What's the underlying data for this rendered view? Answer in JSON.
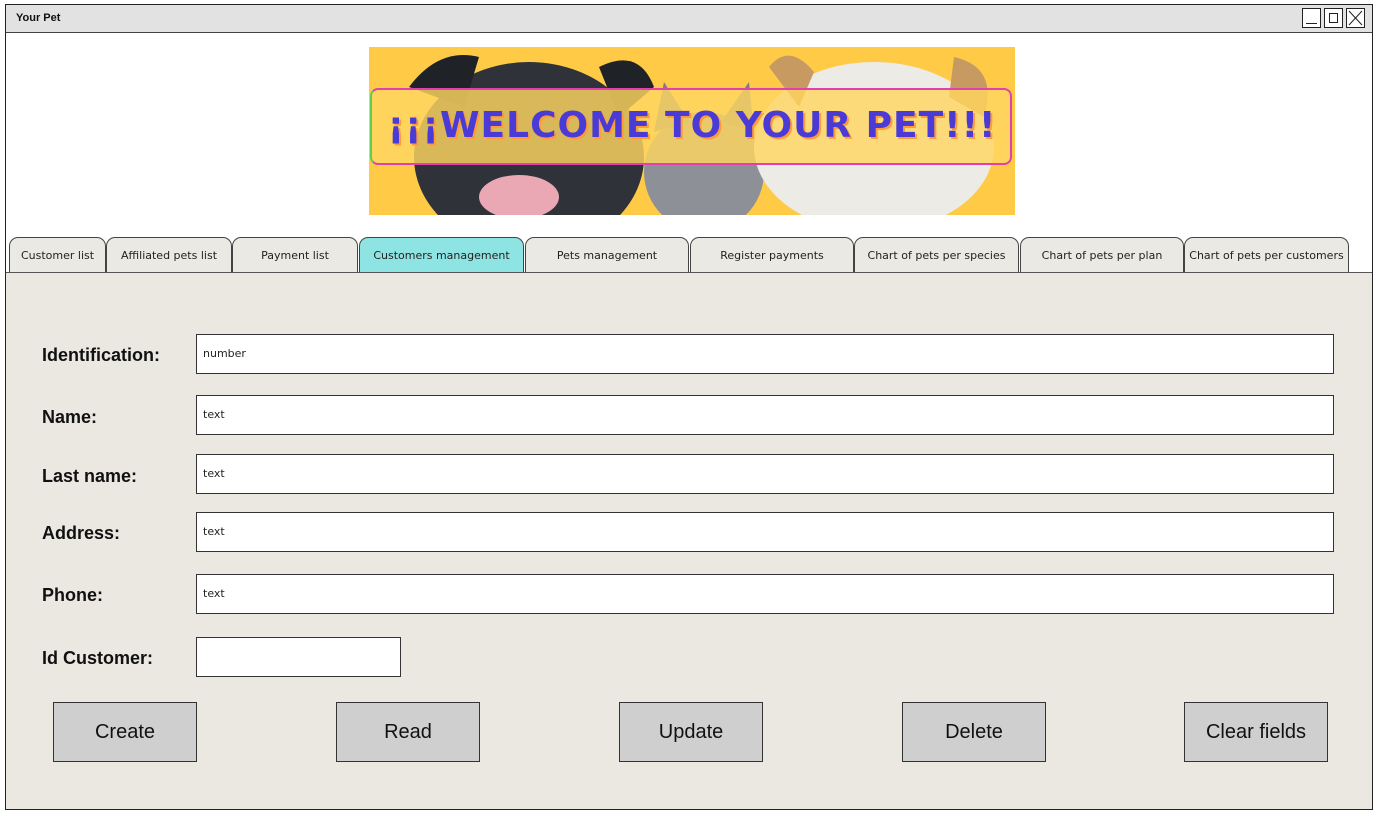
{
  "window": {
    "title": "Your Pet"
  },
  "banner": {
    "text": "¡¡¡WELCOME TO YOUR PET!!!"
  },
  "tabs": [
    {
      "label": "Customer list"
    },
    {
      "label": "Affiliated pets list"
    },
    {
      "label": "Payment list"
    },
    {
      "label": "Customers management",
      "active": true
    },
    {
      "label": "Pets management"
    },
    {
      "label": "Register payments"
    },
    {
      "label": "Chart of pets per species"
    },
    {
      "label": "Chart of pets per plan"
    },
    {
      "label": "Chart of pets per customers"
    }
  ],
  "form": {
    "identification": {
      "label": "Identification:",
      "value": "number"
    },
    "name": {
      "label": "Name:",
      "value": "text"
    },
    "last_name": {
      "label": "Last name:",
      "value": "text"
    },
    "address": {
      "label": "Address:",
      "value": "text"
    },
    "phone": {
      "label": "Phone:",
      "value": "text"
    },
    "id_customer": {
      "label": "Id Customer:",
      "value": ""
    }
  },
  "buttons": {
    "create": "Create",
    "read": "Read",
    "update": "Update",
    "delete": "Delete",
    "clear": "Clear fields"
  },
  "colors": {
    "active_tab": "#8ee4e3",
    "panel_bg": "#eae8e1",
    "banner_bg": "#ffcb47",
    "banner_text": "#4a3bd6"
  }
}
